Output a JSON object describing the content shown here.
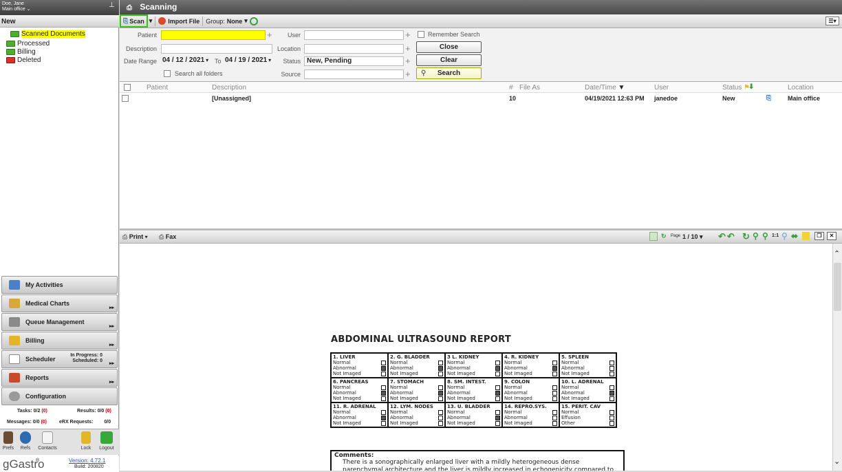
{
  "user": {
    "name": "Doe, Jane",
    "office": "Main office ⌄"
  },
  "left": {
    "header": "New",
    "tree": [
      "Scanned Documents",
      "Processed",
      "Billing",
      "Deleted"
    ],
    "nav": [
      {
        "label": "My Activities",
        "icon": "calendar-icon"
      },
      {
        "label": "Medical Charts",
        "icon": "charts-icon"
      },
      {
        "label": "Queue Management",
        "icon": "queue-icon"
      },
      {
        "label": "Billing",
        "icon": "coins-icon"
      },
      {
        "label": "Scheduler",
        "icon": "scheduler-icon"
      },
      {
        "label": "Reports",
        "icon": "reports-icon"
      },
      {
        "label": "Configuration",
        "icon": "config-icon"
      }
    ],
    "scheduler_progress": "In Progress: 0",
    "scheduler_scheduled": "Scheduled: 0",
    "tasks_label": "Tasks:",
    "tasks_value": "0/2",
    "tasks_red": "(0)",
    "results_label": "Results:",
    "results_value": "0/0",
    "results_red": "(0)",
    "messages_label": "Messages:",
    "messages_value": "0/0",
    "messages_red": "(0)",
    "erx_label": "eRX Requests:",
    "erx_value": "0/0",
    "bottom_buttons": [
      "Prefs",
      "Refs",
      "Contacts",
      "Lock",
      "Logout"
    ],
    "brand": "gGastro",
    "version": "Version: 4.72.1",
    "build": "Build: 200820"
  },
  "title": "Scanning",
  "toolbar": {
    "scan": "Scan",
    "import": "Import File",
    "group_label": "Group:",
    "group_value": "None"
  },
  "filters": {
    "patient_label": "Patient",
    "description_label": "Description",
    "date_label": "Date Range",
    "date_from": "04 / 12 / 2021",
    "to_label": "To",
    "date_to": "04 / 19 / 2021",
    "search_all": "Search all folders",
    "user_label": "User",
    "location_label": "Location",
    "status_label": "Status",
    "status_value": "New, Pending",
    "source_label": "Source",
    "remember": "Remember Search",
    "close": "Close",
    "clear": "Clear",
    "search": "Search"
  },
  "list": {
    "headers": {
      "patient": "Patient",
      "description": "Description",
      "num": "#",
      "file_as": "File As",
      "datetime": "Date/Time",
      "user": "User",
      "status": "Status",
      "location": "Location"
    },
    "row": {
      "description": "[Unassigned]",
      "num": "10",
      "datetime": "04/19/2021 12:63 PM",
      "user": "janedoe",
      "status": "New",
      "location": "Main office"
    }
  },
  "printbar": {
    "print": "Print",
    "fax": "Fax",
    "page_label": "Page",
    "page_value": "1 / 10"
  },
  "document": {
    "title": "ABDOMINAL ULTRASOUND REPORT",
    "cells": [
      {
        "h": "1. LIVER",
        "r": [
          "Normal",
          "Abnormal",
          "Not Imaged"
        ],
        "x": 1
      },
      {
        "h": "2. G. BLADDER",
        "r": [
          "Normal",
          "Abnormal",
          "Not Imaged"
        ],
        "x": 1
      },
      {
        "h": "3 L. KIDNEY",
        "r": [
          "Normal",
          "Abnormal",
          "Not Imaged"
        ],
        "x": 1
      },
      {
        "h": "4. R. KIDNEY",
        "r": [
          "Normal",
          "Abnormal",
          "Not Imaged"
        ],
        "x": 1
      },
      {
        "h": "5. SPLEEN",
        "r": [
          "Normal",
          "Abnormal",
          "Not Imaged"
        ],
        "x": 0
      },
      {
        "h": "6. PANCREAS",
        "r": [
          "Normal",
          "Abnormal",
          "Not Imaged"
        ],
        "x": 1
      },
      {
        "h": "7. STOMACH",
        "r": [
          "Normal",
          "Abnormal",
          "Not Imaged"
        ],
        "x": 1
      },
      {
        "h": "8. SM. INTEST.",
        "r": [
          "Normal",
          "Abnormal",
          "Not Imaged"
        ],
        "x": 1
      },
      {
        "h": "9. COLON",
        "r": [
          "Normal",
          "Abnormal",
          "Not Imaged"
        ],
        "x": 0
      },
      {
        "h": "10. L. ADRENAL",
        "r": [
          "Normal",
          "Abnormal",
          "Not Imaged"
        ],
        "x": 1
      },
      {
        "h": "11. R. ADRENAL",
        "r": [
          "Normal",
          "Abnormal",
          "Not Imaged"
        ],
        "x": 1
      },
      {
        "h": "12. LYM. NODES",
        "r": [
          "Normal",
          "Abnormal",
          "Not Imaged"
        ],
        "x": 0
      },
      {
        "h": "13. U. BLADDER",
        "r": [
          "Normal",
          "Abnormal",
          "Not Imaged"
        ],
        "x": 1
      },
      {
        "h": "14. REPRO.SYS.",
        "r": [
          "Normal",
          "Abnormal",
          "Not Imaged"
        ],
        "x": 0
      },
      {
        "h": "15. PERIT. CAV",
        "r": [
          "Normal",
          "Effusion",
          "Other"
        ],
        "x": 0
      }
    ],
    "comments_label": "Comments:",
    "comments_text": "There is a sonographically enlarged liver with a mildly heterogeneous dense parenchymal architecture and the liver is mildly increased in echogenicity compared to the kidney"
  }
}
